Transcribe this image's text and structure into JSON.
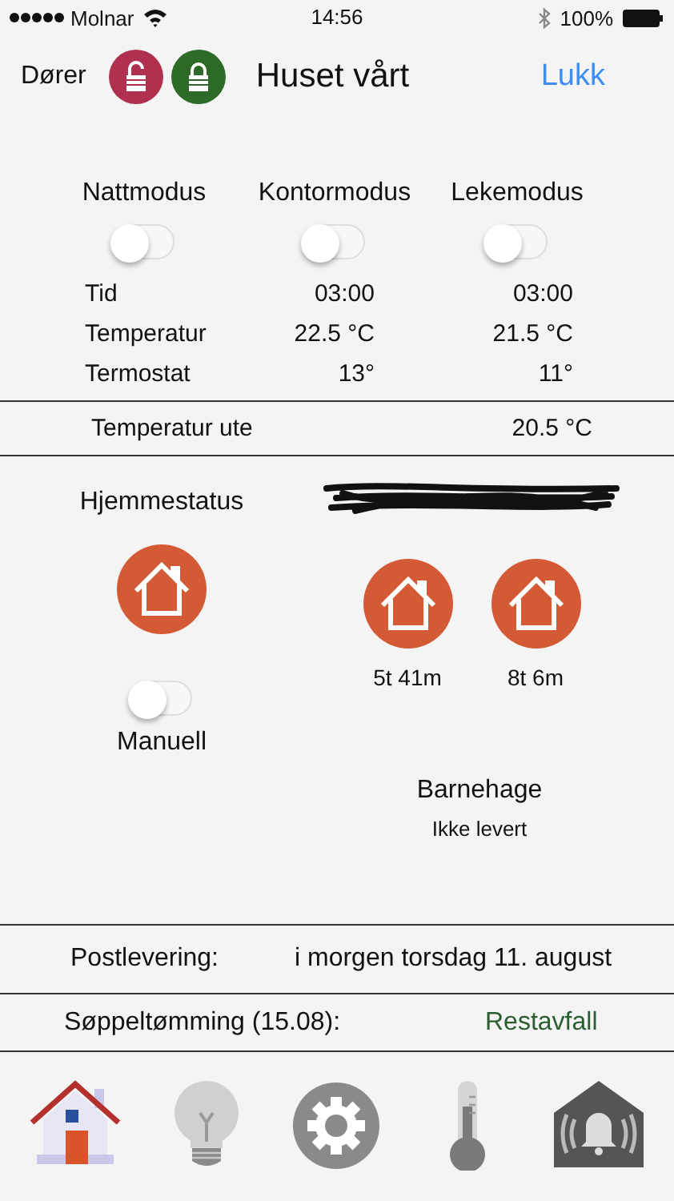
{
  "status_bar": {
    "carrier": "Molnar",
    "time": "14:56",
    "battery": "100%"
  },
  "nav": {
    "left_label": "Dører",
    "title": "Huset vårt",
    "action": "Lukk",
    "locks": [
      {
        "kind": "unlocked",
        "color": "#b0304f"
      },
      {
        "kind": "locked",
        "color": "#2d6a27"
      }
    ]
  },
  "modes": [
    {
      "label": "Nattmodus",
      "on": false
    },
    {
      "label": "Kontormodus",
      "on": false
    },
    {
      "label": "Lekemodus",
      "on": false
    }
  ],
  "mode_table": [
    {
      "label": "Tid",
      "values": [
        "03:00",
        "03:00"
      ]
    },
    {
      "label": "Temperatur",
      "values": [
        "22.5 °C",
        "21.5 °C"
      ]
    },
    {
      "label": "Termostat",
      "values": [
        "13°",
        "11°"
      ]
    }
  ],
  "outdoor": {
    "label": "Temperatur ute",
    "value": "20.5 °C"
  },
  "home_status": {
    "title": "Hjemmestatus",
    "manual": {
      "label": "Manuell",
      "on": false
    }
  },
  "persons": [
    {
      "time": "5t 41m"
    },
    {
      "time": "8t 6m"
    }
  ],
  "kindergarten": {
    "title": "Barnehage",
    "status": "Ikke levert"
  },
  "info_rows": [
    {
      "label": "Postlevering:",
      "value": "i morgen torsdag 11. august",
      "color": "#111111"
    },
    {
      "label": "Søppeltømming (15.08):",
      "value": "Restavfall",
      "color": "#2a5e30"
    }
  ],
  "tabbar": [
    {
      "kind": "home",
      "selected": true
    },
    {
      "kind": "bulb",
      "selected": false
    },
    {
      "kind": "gear",
      "selected": false
    },
    {
      "kind": "thermometer",
      "selected": false
    },
    {
      "kind": "alarm",
      "selected": false
    }
  ]
}
